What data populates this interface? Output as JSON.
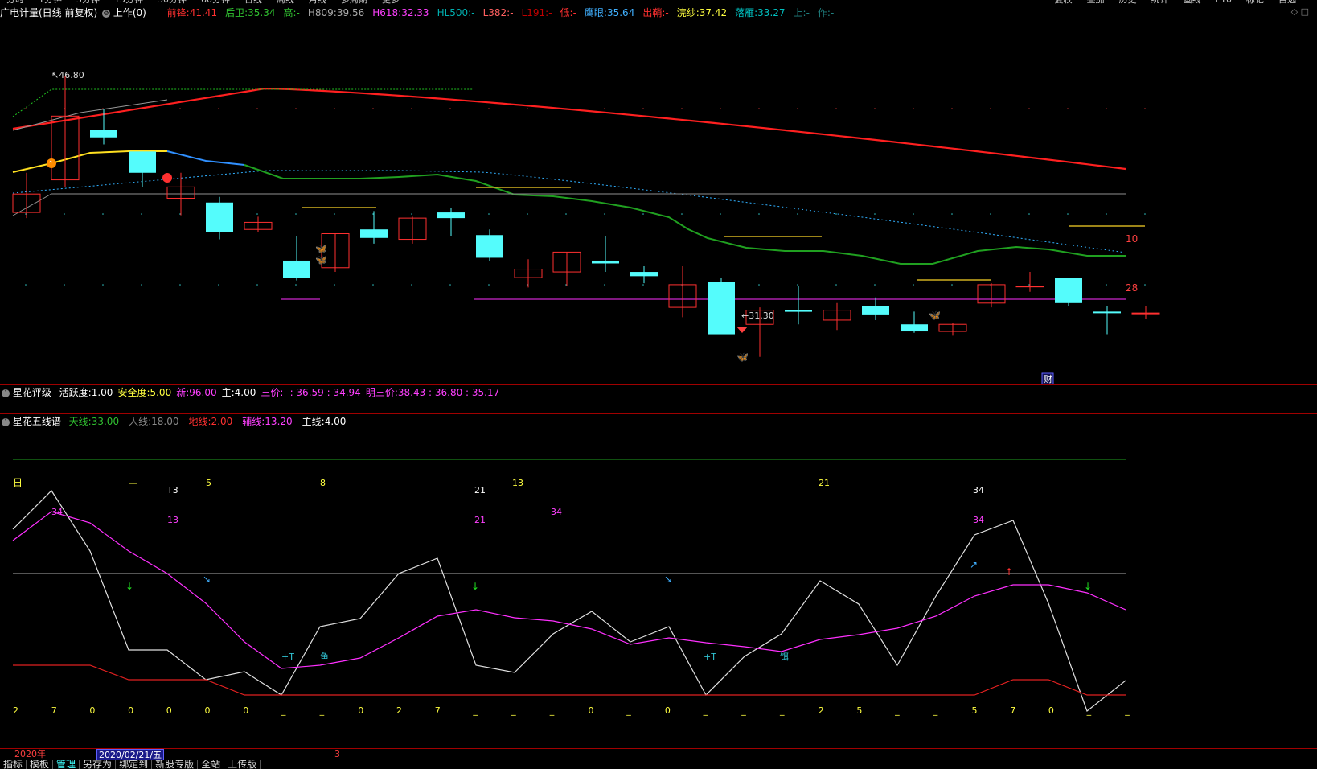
{
  "toolbar": {
    "items": [
      "分时",
      "1分钟",
      "5分钟",
      "15分钟",
      "30分钟",
      "60分钟",
      "日线",
      "周线",
      "月线",
      "多周期",
      "更多"
    ],
    "right_items": [
      "复权",
      "叠加",
      "历史",
      "统计",
      "画线",
      "F10",
      "标记",
      "自选"
    ]
  },
  "main_header": {
    "title": "广电计量(日线 前复权)",
    "indicator_name": "上作(0)",
    "fields": [
      {
        "label": "前锋:",
        "value": "41.41",
        "color": "#ff3030"
      },
      {
        "label": "后卫:",
        "value": "35.34",
        "color": "#30c030"
      },
      {
        "label": "高:",
        "value": "-",
        "color": "#30c030"
      },
      {
        "label": "H809:",
        "value": "39.56",
        "color": "#aaaaaa"
      },
      {
        "label": "H618:",
        "value": "32.33",
        "color": "#ff40ff"
      },
      {
        "label": "HL500:",
        "value": "-",
        "color": "#00b0b0"
      },
      {
        "label": "L382:",
        "value": "-",
        "color": "#ff6060"
      },
      {
        "label": "L191:",
        "value": "-",
        "color": "#c00000"
      },
      {
        "label": "低:",
        "value": "-",
        "color": "#ff3030"
      },
      {
        "label": "鹰眼:",
        "value": "35.64",
        "color": "#40b0ff"
      },
      {
        "label": "出鞘:",
        "value": "-",
        "color": "#ff3030"
      },
      {
        "label": "浣纱:",
        "value": "37.42",
        "color": "#ffff40"
      },
      {
        "label": "落雁:",
        "value": "33.27",
        "color": "#00c0c0"
      },
      {
        "label": "上:",
        "value": "-",
        "color": "#208080"
      },
      {
        "label": "作:",
        "value": "-",
        "color": "#208080"
      }
    ]
  },
  "price_labels": {
    "high": "46.80",
    "low": "31.30",
    "right_top": "10",
    "right_bottom": "28",
    "finance_badge": "财"
  },
  "panel2_header": {
    "title": "星花评级",
    "fields": [
      {
        "label": "活跃度:",
        "value": "1.00",
        "color": "#ffffff"
      },
      {
        "label": "安全度:",
        "value": "5.00",
        "color": "#ffff40"
      },
      {
        "label": "新:",
        "value": "96.00",
        "color": "#ff40ff"
      },
      {
        "label": "主:",
        "value": "4.00",
        "color": "#ffffff"
      },
      {
        "label": "三价:",
        "value": "-  : 36.59  : 34.94",
        "color": "#ff40ff"
      },
      {
        "label": "明三价:",
        "value": "38.43  : 36.80  : 35.17",
        "color": "#ff40ff"
      }
    ]
  },
  "panel3_header": {
    "title": "星花五线谱",
    "fields": [
      {
        "label": "天线:",
        "value": "33.00",
        "color": "#30c030"
      },
      {
        "label": "人线:",
        "value": "18.00",
        "color": "#888888"
      },
      {
        "label": "地线:",
        "value": "2.00",
        "color": "#ff3030"
      },
      {
        "label": "辅线:",
        "value": "13.20",
        "color": "#ff40ff"
      },
      {
        "label": "主线:",
        "value": "4.00",
        "color": "#ffffff"
      }
    ]
  },
  "panel3_labels": {
    "day": "日",
    "top_marks": [
      "—",
      "T3",
      "5",
      "8",
      "21",
      "13",
      "21",
      "34"
    ],
    "mid_marks": [
      "34",
      "13",
      "21",
      "34",
      "34"
    ],
    "markers": [
      "+T",
      "鱼",
      "+T",
      "饵"
    ],
    "bottom_numbers": [
      "2",
      "7",
      "0",
      "0",
      "0",
      "0",
      "0",
      "_",
      "_",
      "0",
      "2",
      "7",
      "_",
      "_",
      "_",
      "0",
      "_",
      "0",
      "_",
      "_",
      "_",
      "2",
      "5",
      "_",
      "_",
      "5",
      "7",
      "0",
      "_",
      "_"
    ]
  },
  "timeline": {
    "year": "2020年",
    "cursor_date": "2020/02/21/五",
    "marker": "3"
  },
  "bottom_tabs": [
    "指标",
    "模板",
    "管理",
    "另存为",
    "绑定到",
    "新股专版",
    "全站",
    "上传版"
  ],
  "colors": {
    "bg": "#000000",
    "red_line": "#ff2020",
    "green_line": "#20a020",
    "cyan": "#54fcfc",
    "magenta": "#ff30ff",
    "yellow": "#ffff30"
  },
  "chart_data": {
    "type": "candlestick",
    "candles": [
      {
        "o": 38.5,
        "c": 37.2,
        "h": 40.0,
        "l": 36.8,
        "up": true
      },
      {
        "o": 39.5,
        "c": 44.0,
        "h": 46.8,
        "l": 39.0,
        "up": true
      },
      {
        "o": 43.0,
        "c": 42.5,
        "h": 44.5,
        "l": 42.0,
        "up": false
      },
      {
        "o": 41.5,
        "c": 40.0,
        "h": 41.5,
        "l": 39.0,
        "up": false
      },
      {
        "o": 38.2,
        "c": 39.0,
        "h": 40.0,
        "l": 37.0,
        "up": true
      },
      {
        "o": 37.9,
        "c": 35.8,
        "h": 38.3,
        "l": 35.3,
        "up": false
      },
      {
        "o": 36.0,
        "c": 36.5,
        "h": 36.9,
        "l": 35.8,
        "up": true
      },
      {
        "o": 33.8,
        "c": 32.6,
        "h": 35.5,
        "l": 32.4,
        "up": false
      },
      {
        "o": 33.3,
        "c": 35.7,
        "h": 35.7,
        "l": 33.0,
        "up": true
      },
      {
        "o": 36.0,
        "c": 35.4,
        "h": 37.3,
        "l": 35.0,
        "up": false
      },
      {
        "o": 35.3,
        "c": 36.8,
        "h": 36.9,
        "l": 35.0,
        "up": true
      },
      {
        "o": 36.8,
        "c": 37.2,
        "h": 37.5,
        "l": 35.5,
        "up": false
      },
      {
        "o": 35.6,
        "c": 34.0,
        "h": 36.0,
        "l": 33.8,
        "up": false
      },
      {
        "o": 32.6,
        "c": 33.2,
        "h": 33.9,
        "l": 31.9,
        "up": true
      },
      {
        "o": 33.0,
        "c": 34.4,
        "h": 34.4,
        "l": 32.0,
        "up": true
      },
      {
        "o": 33.8,
        "c": 33.6,
        "h": 35.5,
        "l": 33.0,
        "up": false
      },
      {
        "o": 33.0,
        "c": 32.7,
        "h": 33.4,
        "l": 32.2,
        "up": false
      },
      {
        "o": 30.5,
        "c": 32.1,
        "h": 33.4,
        "l": 29.8,
        "up": true
      },
      {
        "o": 32.3,
        "c": 28.6,
        "h": 32.6,
        "l": 28.6,
        "up": false
      },
      {
        "o": 29.3,
        "c": 30.3,
        "h": 30.5,
        "l": 27.0,
        "up": true
      },
      {
        "o": 30.3,
        "c": 30.3,
        "h": 32.0,
        "l": 29.3,
        "up": false
      },
      {
        "o": 29.6,
        "c": 30.3,
        "h": 30.8,
        "l": 28.9,
        "up": true
      },
      {
        "o": 30.6,
        "c": 30.0,
        "h": 31.2,
        "l": 29.6,
        "up": false
      },
      {
        "o": 29.3,
        "c": 28.8,
        "h": 30.2,
        "l": 28.7,
        "up": false
      },
      {
        "o": 28.8,
        "c": 29.3,
        "h": 29.4,
        "l": 28.5,
        "up": true
      },
      {
        "o": 30.8,
        "c": 32.1,
        "h": 32.2,
        "l": 30.5,
        "up": true
      },
      {
        "o": 32.0,
        "c": 32.0,
        "h": 33.0,
        "l": 31.6,
        "up": true
      },
      {
        "o": 32.6,
        "c": 30.8,
        "h": 32.6,
        "l": 30.6,
        "up": false
      },
      {
        "o": 30.2,
        "c": 30.2,
        "h": 30.6,
        "l": 28.6,
        "up": false
      },
      {
        "o": 30.1,
        "c": 30.1,
        "h": 30.6,
        "l": 29.7,
        "up": true
      }
    ]
  }
}
